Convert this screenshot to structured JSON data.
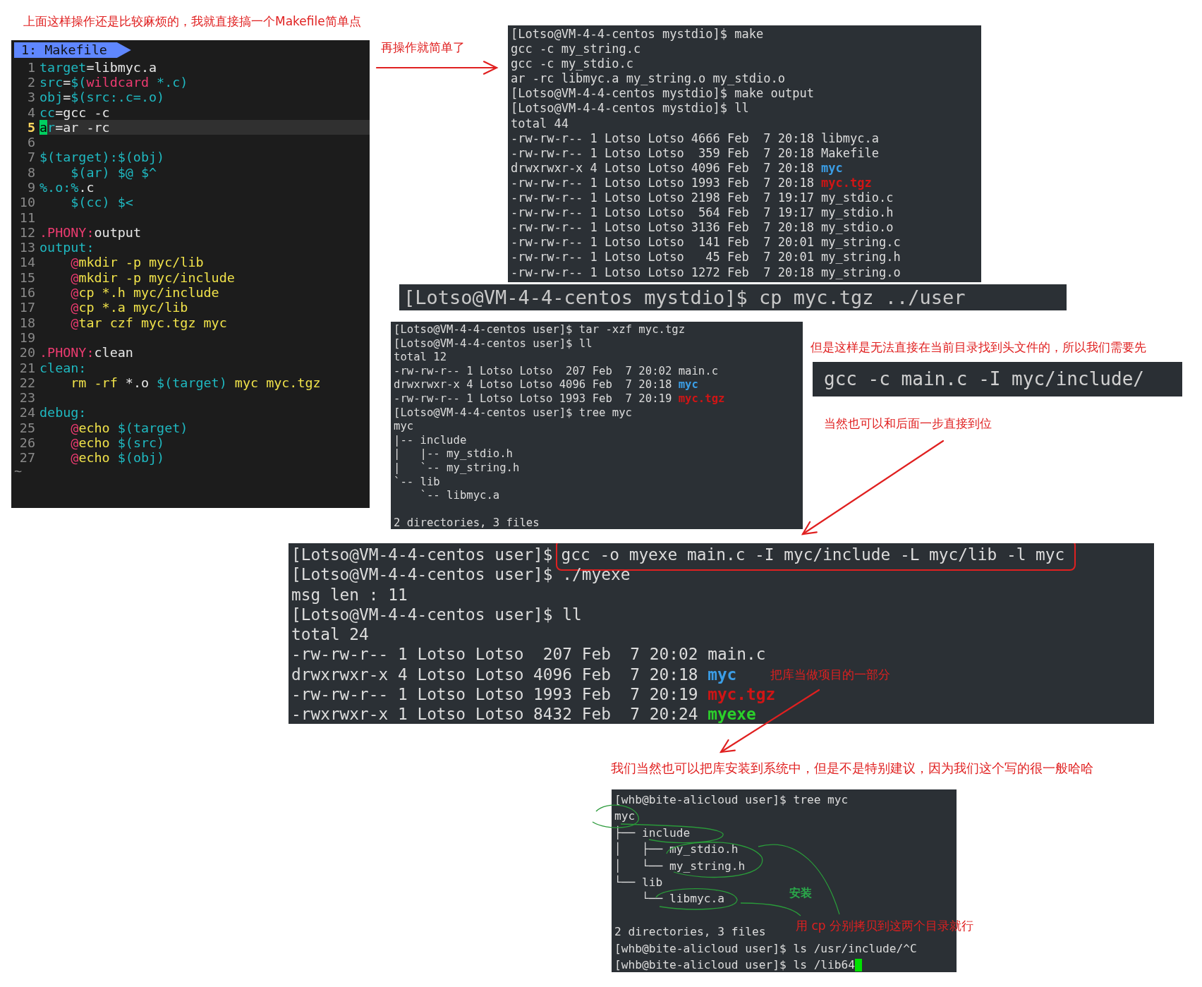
{
  "annotations": [
    {
      "text": "上面这样操作还是比较麻烦的，我就直接搞一个Makefile简单点",
      "color": "#e02020"
    },
    {
      "text": "再操作就简单了",
      "color": "#e02020"
    },
    {
      "text": "但是这样是无法直接在当前目录找到头文件的，所以我们需要先",
      "color": "#e02020"
    },
    {
      "text": "当然也可以和后面一步直接到位",
      "color": "#e02020"
    },
    {
      "text": "把库当做项目的一部分",
      "color": "#e02020"
    },
    {
      "text": "我们当然也可以把库安装到系统中，但是不是特别建议，因为我们这个写的很一般哈哈",
      "color": "#e02020"
    },
    {
      "text": "安装",
      "color": "#2aa84a"
    },
    {
      "text": "用 cp 分别拷贝到这两个目录就行",
      "color": "#e02020"
    }
  ],
  "editor": {
    "tab": "1: Makefile",
    "tilde": "~",
    "lines": [
      {
        "number": "1",
        "current": false,
        "segments": [
          {
            "text": "target",
            "kind": "var"
          },
          {
            "text": "=libmyc.a",
            "kind": "plain"
          }
        ]
      },
      {
        "number": "2",
        "current": false,
        "segments": [
          {
            "text": "src",
            "kind": "var"
          },
          {
            "text": "=",
            "kind": "plain"
          },
          {
            "text": "$(",
            "kind": "var"
          },
          {
            "text": "wildcard",
            "kind": "func"
          },
          {
            "text": " *.c)",
            "kind": "var"
          }
        ]
      },
      {
        "number": "3",
        "current": false,
        "segments": [
          {
            "text": "obj",
            "kind": "var"
          },
          {
            "text": "=",
            "kind": "plain"
          },
          {
            "text": "$(src:.c=.o)",
            "kind": "var"
          }
        ]
      },
      {
        "number": "4",
        "current": false,
        "segments": [
          {
            "text": "cc",
            "kind": "var"
          },
          {
            "text": "=gcc -c",
            "kind": "plain"
          }
        ]
      },
      {
        "number": "5",
        "current": true,
        "segments": [
          {
            "text": "a",
            "kind": "cursor"
          },
          {
            "text": "r",
            "kind": "var"
          },
          {
            "text": "=ar -rc",
            "kind": "plain"
          }
        ]
      },
      {
        "number": "6",
        "current": false
      },
      {
        "number": "7",
        "current": false,
        "segments": [
          {
            "text": "$(target):$(obj)",
            "kind": "var"
          }
        ]
      },
      {
        "number": "8",
        "current": false,
        "segments": [
          {
            "text": "    $(ar) $@ $^",
            "kind": "var"
          }
        ]
      },
      {
        "number": "9",
        "current": false,
        "segments": [
          {
            "text": "%.o:%",
            "kind": "var"
          },
          {
            "text": ".c",
            "kind": "plain"
          }
        ]
      },
      {
        "number": "10",
        "current": false,
        "segments": [
          {
            "text": "    $(cc) $<",
            "kind": "var"
          }
        ]
      },
      {
        "number": "11",
        "current": false
      },
      {
        "number": "12",
        "current": false,
        "segments": [
          {
            "text": ".PHONY:",
            "kind": "func"
          },
          {
            "text": "output",
            "kind": "plain"
          }
        ]
      },
      {
        "number": "13",
        "current": false,
        "segments": [
          {
            "text": "output:",
            "kind": "var"
          }
        ]
      },
      {
        "number": "14",
        "current": false,
        "segments": [
          {
            "text": "    @",
            "kind": "func"
          },
          {
            "text": "mkdir -p myc/lib",
            "kind": "cmd"
          }
        ]
      },
      {
        "number": "15",
        "current": false,
        "segments": [
          {
            "text": "    @",
            "kind": "func"
          },
          {
            "text": "mkdir -p myc/include",
            "kind": "cmd"
          }
        ]
      },
      {
        "number": "16",
        "current": false,
        "segments": [
          {
            "text": "    @",
            "kind": "func"
          },
          {
            "text": "cp *.h myc/include",
            "kind": "cmd"
          }
        ]
      },
      {
        "number": "17",
        "current": false,
        "segments": [
          {
            "text": "    @",
            "kind": "func"
          },
          {
            "text": "cp *.a myc/lib",
            "kind": "cmd"
          }
        ]
      },
      {
        "number": "18",
        "current": false,
        "segments": [
          {
            "text": "    @",
            "kind": "func"
          },
          {
            "text": "tar czf myc.tgz myc",
            "kind": "cmd"
          }
        ]
      },
      {
        "number": "19",
        "current": false
      },
      {
        "number": "20",
        "current": false,
        "segments": [
          {
            "text": ".PHONY:",
            "kind": "func"
          },
          {
            "text": "clean",
            "kind": "plain"
          }
        ]
      },
      {
        "number": "21",
        "current": false,
        "segments": [
          {
            "text": "clean:",
            "kind": "var"
          }
        ]
      },
      {
        "number": "22",
        "current": false,
        "segments": [
          {
            "text": "    rm -rf",
            "kind": "cmd"
          },
          {
            "text": " *.o ",
            "kind": "plain"
          },
          {
            "text": "$(target)",
            "kind": "var"
          },
          {
            "text": " myc myc.tgz",
            "kind": "cmd"
          }
        ]
      },
      {
        "number": "23",
        "current": false
      },
      {
        "number": "24",
        "current": false,
        "segments": [
          {
            "text": "debug:",
            "kind": "var"
          }
        ]
      },
      {
        "number": "25",
        "current": false,
        "segments": [
          {
            "text": "    @",
            "kind": "func"
          },
          {
            "text": "echo ",
            "kind": "cmd"
          },
          {
            "text": "$(target)",
            "kind": "var"
          }
        ]
      },
      {
        "number": "26",
        "current": false,
        "segments": [
          {
            "text": "    @",
            "kind": "func"
          },
          {
            "text": "echo ",
            "kind": "cmd"
          },
          {
            "text": "$(src)",
            "kind": "var"
          }
        ]
      },
      {
        "number": "27",
        "current": false,
        "segments": [
          {
            "text": "    @",
            "kind": "func"
          },
          {
            "text": "echo ",
            "kind": "cmd"
          },
          {
            "text": "$(obj)",
            "kind": "var"
          }
        ]
      }
    ]
  },
  "terminals": [
    {
      "lines": [
        {
          "text": "[Lotso@VM-4-4-centos mystdio]$ make"
        },
        {
          "text": "gcc -c my_string.c"
        },
        {
          "text": "gcc -c my_stdio.c"
        },
        {
          "text": "ar -rc libmyc.a my_string.o my_stdio.o"
        },
        {
          "text": "[Lotso@VM-4-4-centos mystdio]$ make output"
        },
        {
          "text": "[Lotso@VM-4-4-centos mystdio]$ ll"
        },
        {
          "text": "total 44"
        },
        {
          "text": "-rw-rw-r-- 1 Lotso Lotso 4666 Feb  7 20:18 libmyc.a"
        },
        {
          "text": "-rw-rw-r-- 1 Lotso Lotso  359 Feb  7 20:18 Makefile"
        },
        {
          "segments": [
            {
              "text": "drwxrwxr-x 4 Lotso Lotso 4096 Feb  7 20:18 ",
              "kind": "plain"
            },
            {
              "text": "myc",
              "kind": "dir"
            }
          ]
        },
        {
          "segments": [
            {
              "text": "-rw-rw-r-- 1 Lotso Lotso 1993 Feb  7 20:18 ",
              "kind": "plain"
            },
            {
              "text": "myc.tgz",
              "kind": "archive"
            }
          ]
        },
        {
          "text": "-rw-rw-r-- 1 Lotso Lotso 2198 Feb  7 19:17 my_stdio.c"
        },
        {
          "text": "-rw-rw-r-- 1 Lotso Lotso  564 Feb  7 19:17 my_stdio.h"
        },
        {
          "text": "-rw-rw-r-- 1 Lotso Lotso 3136 Feb  7 20:18 my_stdio.o"
        },
        {
          "text": "-rw-rw-r-- 1 Lotso Lotso  141 Feb  7 20:01 my_string.c"
        },
        {
          "text": "-rw-rw-r-- 1 Lotso Lotso   45 Feb  7 20:01 my_string.h"
        },
        {
          "text": "-rw-rw-r-- 1 Lotso Lotso 1272 Feb  7 20:18 my_string.o"
        }
      ]
    },
    {
      "lines": [
        {
          "text": "[Lotso@VM-4-4-centos mystdio]$ cp myc.tgz ../user"
        }
      ]
    },
    {
      "lines": [
        {
          "text": "[Lotso@VM-4-4-centos user]$ tar -xzf myc.tgz"
        },
        {
          "text": "[Lotso@VM-4-4-centos user]$ ll"
        },
        {
          "text": "total 12"
        },
        {
          "text": "-rw-rw-r-- 1 Lotso Lotso  207 Feb  7 20:02 main.c"
        },
        {
          "segments": [
            {
              "text": "drwxrwxr-x 4 Lotso Lotso 4096 Feb  7 20:18 ",
              "kind": "plain"
            },
            {
              "text": "myc",
              "kind": "dir"
            }
          ]
        },
        {
          "segments": [
            {
              "text": "-rw-rw-r-- 1 Lotso Lotso 1993 Feb  7 20:19 ",
              "kind": "plain"
            },
            {
              "text": "myc.tgz",
              "kind": "archive"
            }
          ]
        },
        {
          "text": "[Lotso@VM-4-4-centos user]$ tree myc"
        },
        {
          "text": "myc"
        },
        {
          "text": "|-- include"
        },
        {
          "text": "|   |-- my_stdio.h"
        },
        {
          "text": "|   `-- my_string.h"
        },
        {
          "text": "`-- lib"
        },
        {
          "text": "    `-- libmyc.a"
        },
        {
          "text": "2 directories, 3 files",
          "space_before": true
        }
      ]
    },
    {
      "lines": [
        {
          "text": "gcc -c main.c -I myc/include/"
        }
      ]
    },
    {
      "lines": [
        {
          "segments": [
            {
              "text": "[Lotso@VM-4-4-centos user]$",
              "kind": "plain"
            },
            {
              "text": "gcc -o myexe main.c -I myc/include -L myc/lib -l myc",
              "kind": "framed"
            }
          ]
        },
        {
          "text": "[Lotso@VM-4-4-centos user]$ ./myexe"
        },
        {
          "text": "msg len : 11"
        },
        {
          "text": "[Lotso@VM-4-4-centos user]$ ll"
        },
        {
          "text": "total 24"
        },
        {
          "text": "-rw-rw-r-- 1 Lotso Lotso  207 Feb  7 20:02 main.c"
        },
        {
          "segments": [
            {
              "text": "drwxrwxr-x 4 Lotso Lotso 4096 Feb  7 20:18 ",
              "kind": "plain"
            },
            {
              "text": "myc",
              "kind": "dir"
            }
          ]
        },
        {
          "segments": [
            {
              "text": "-rw-rw-r-- 1 Lotso Lotso 1993 Feb  7 20:19 ",
              "kind": "plain"
            },
            {
              "text": "myc.tgz",
              "kind": "archive"
            }
          ]
        },
        {
          "segments": [
            {
              "text": "-rwxrwxr-x 1 Lotso Lotso 8432 Feb  7 20:24 ",
              "kind": "plain"
            },
            {
              "text": "myexe",
              "kind": "exec"
            }
          ]
        }
      ]
    },
    {
      "lines": [
        {
          "text": "[whb@bite-alicloud user]$ tree myc"
        },
        {
          "text": "myc"
        },
        {
          "text": "├── include"
        },
        {
          "text": "│   ├── my_stdio.h"
        },
        {
          "text": "│   └── my_string.h"
        },
        {
          "text": "└── lib"
        },
        {
          "text": "    └── libmyc.a"
        },
        {
          "text": "2 directories, 3 files",
          "space_before": true
        },
        {
          "text": "[whb@bite-alicloud user]$ ls /usr/include/^C"
        },
        {
          "text": "[whb@bite-alicloud user]$ ls /lib64",
          "cursor": true
        }
      ]
    }
  ]
}
